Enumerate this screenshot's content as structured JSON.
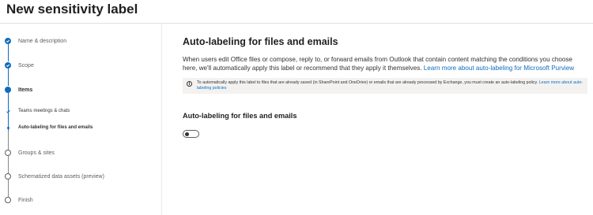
{
  "page": {
    "title": "New sensitivity label"
  },
  "nav": {
    "steps": [
      {
        "label": "Name & description",
        "state": "completed"
      },
      {
        "label": "Scope",
        "state": "completed"
      },
      {
        "label": "Items",
        "state": "current"
      },
      {
        "label": "Teams meetings & chats",
        "state": "completed-sub"
      },
      {
        "label": "Auto-labeling for files and emails",
        "state": "current-sub"
      },
      {
        "label": "Groups & sites",
        "state": "pending"
      },
      {
        "label": "Schematized data assets (preview)",
        "state": "pending"
      },
      {
        "label": "Finish",
        "state": "pending"
      }
    ]
  },
  "main": {
    "heading": "Auto-labeling for files and emails",
    "description": "When users edit Office files or compose, reply to, or forward emails from Outlook that contain content matching the conditions you choose here, we'll automatically apply this label or recommend that they apply it themselves.",
    "description_link": "Learn more about auto-labeling for Microsoft Purview",
    "info_text": "To automatically apply this label to files that are already saved (in SharePoint and OneDrive) or emails that are already processed by Exchange, you must create an auto-labeling policy.",
    "info_link": "Learn more about auto-labeling policies",
    "toggle_label": "Auto-labeling for files and emails",
    "toggle_state": "off"
  },
  "colors": {
    "accent": "#0f6cbd",
    "info_bg": "#f3f2f1"
  }
}
